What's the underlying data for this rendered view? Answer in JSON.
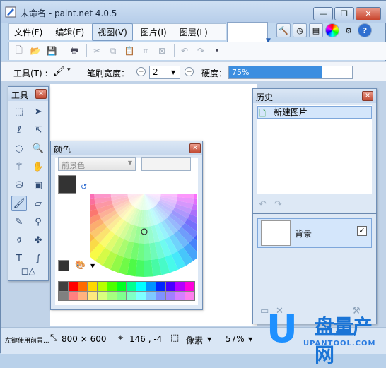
{
  "window": {
    "title": "未命名 - paint.net 4.0.5",
    "min_label": "—",
    "max_label": "❐",
    "close_label": "✕"
  },
  "menu": {
    "items": [
      {
        "label": "文件(F)"
      },
      {
        "label": "编辑(E)"
      },
      {
        "label": "视图(V)"
      },
      {
        "label": "图片(I)"
      },
      {
        "label": "图层(L)"
      }
    ]
  },
  "toolbar2": {
    "tool_label": "工具(T) :",
    "brush_width_label": "笔刷宽度：",
    "brush_width_value": "2",
    "hardness_label": "硬度：",
    "hardness_value": "75%",
    "hardness_fraction": 0.75
  },
  "tools_panel": {
    "title": "工具"
  },
  "colors_panel": {
    "title": "颜色",
    "primary_select": "前景色",
    "palette": [
      "#404040",
      "#ff0000",
      "#ff6a00",
      "#ffd800",
      "#b6ff00",
      "#4cff00",
      "#00ff21",
      "#00ff90",
      "#00ffff",
      "#0094ff",
      "#0026ff",
      "#4800ff",
      "#b200ff",
      "#ff00dc",
      "#808080",
      "#ff8080",
      "#ffb27f",
      "#ffe97f",
      "#daff7f",
      "#a5ff7f",
      "#7fff8e",
      "#7fffc5",
      "#7fffff",
      "#7fc9ff",
      "#7f92ff",
      "#a17fff",
      "#d67fff",
      "#ff7fed"
    ]
  },
  "history_panel": {
    "title": "历史",
    "items": [
      {
        "label": "新建图片"
      }
    ]
  },
  "layers_panel": {
    "layers": [
      {
        "name": "背景",
        "visible": "✓"
      }
    ]
  },
  "status": {
    "hint": "左键使用前景...",
    "size": "800 × 600",
    "position": "146 , -4",
    "unit": "像素",
    "zoom": "57%"
  },
  "watermark": {
    "logo_letter": "U",
    "brand": "盘量产网",
    "url": "UPANTOOL.COM"
  }
}
